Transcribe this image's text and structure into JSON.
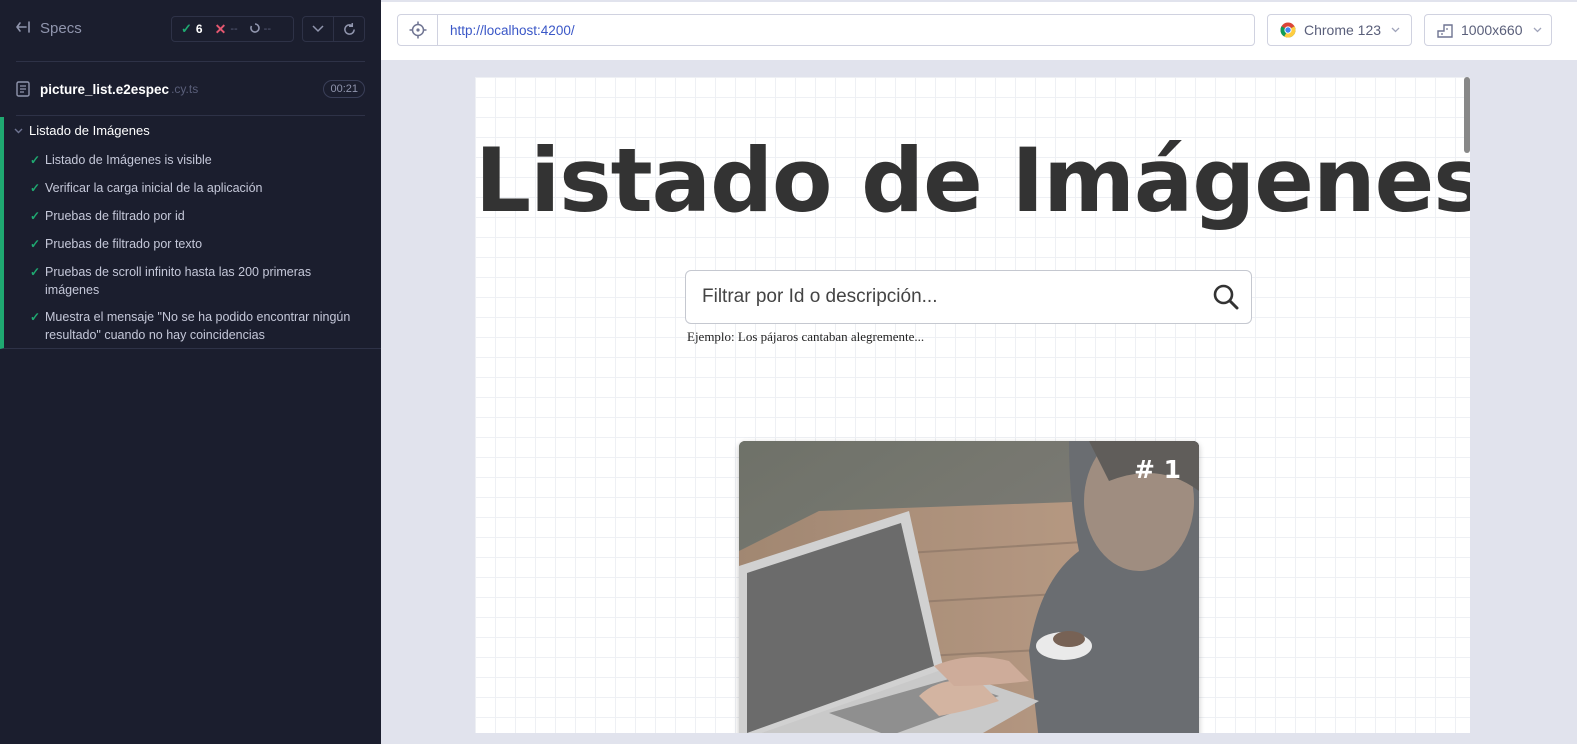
{
  "sidebar": {
    "specs_label": "Specs",
    "stats": {
      "passed": "6",
      "failed": "--",
      "pending": "--"
    },
    "spec_file": {
      "name": "picture_list.e2espec",
      "ext": ".cy.ts",
      "duration": "00:21"
    },
    "suite": {
      "title": "Listado de Imágenes",
      "tests": [
        "Listado de Imágenes is visible",
        "Verificar la carga inicial de la aplicación",
        "Pruebas de filtrado por id",
        "Pruebas de filtrado por texto",
        "Pruebas de scroll infinito hasta las 200 primeras imágenes",
        "Muestra el mensaje \"No se ha podido encontrar ningún resultado\" cuando no hay coincidencias"
      ]
    }
  },
  "topbar": {
    "url": "http://localhost:4200/",
    "browser": "Chrome 123",
    "viewport": "1000x660"
  },
  "app": {
    "title": "Listado de Imágenes",
    "search_placeholder": "Filtrar por Id o descripción...",
    "hint": "Ejemplo: Los pájaros cantaban alegremente...",
    "card": {
      "number": "# 1"
    }
  },
  "colors": {
    "pass": "#1fa971",
    "fail": "#e45770",
    "sidebar_bg": "#1b1e2e",
    "url": "#3a57c7"
  }
}
